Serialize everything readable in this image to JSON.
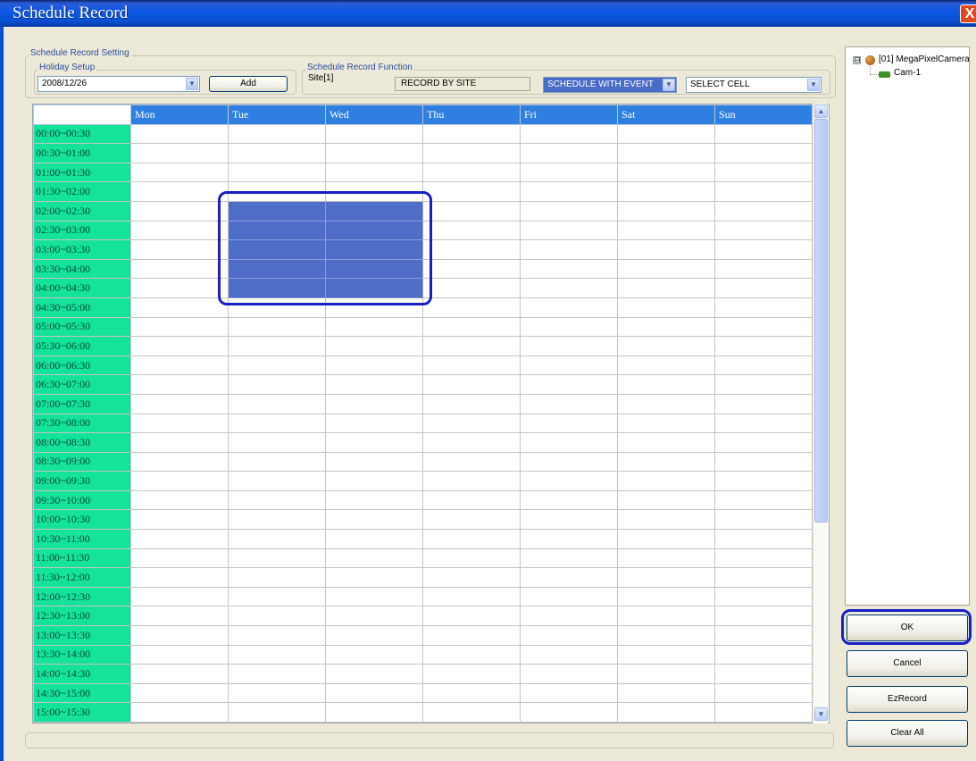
{
  "window": {
    "title": "Schedule Record",
    "close_glyph": "X"
  },
  "settings": {
    "group_label": "Schedule Record Setting",
    "holiday": {
      "label": "Holiday Setup",
      "date_value": "2008/12/26",
      "add_label": "Add"
    },
    "function": {
      "label": "Schedule Record Function",
      "site_label": "Site[1]",
      "record_mode": "RECORD BY SITE",
      "schedule_mode": "SCHEDULE WITH EVENT",
      "cell_mode": "SELECT CELL"
    }
  },
  "grid": {
    "days": [
      "Mon",
      "Tue",
      "Wed",
      "Thu",
      "Fri",
      "Sat",
      "Sun"
    ],
    "times": [
      "00:00~00:30",
      "00:30~01:00",
      "01:00~01:30",
      "01:30~02:00",
      "02:00~02:30",
      "02:30~03:00",
      "03:00~03:30",
      "03:30~04:00",
      "04:00~04:30",
      "04:30~05:00",
      "05:00~05:30",
      "05:30~06:00",
      "06:00~06:30",
      "06:30~07:00",
      "07:00~07:30",
      "07:30~08:00",
      "08:00~08:30",
      "08:30~09:00",
      "09:00~09:30",
      "09:30~10:00",
      "10:00~10:30",
      "10:30~11:00",
      "11:00~11:30",
      "11:30~12:00",
      "12:00~12:30",
      "12:30~13:00",
      "13:00~13:30",
      "13:30~14:00",
      "14:00~14:30",
      "14:30~15:00",
      "15:00~15:30"
    ],
    "selected": {
      "days": [
        "Tue",
        "Wed"
      ],
      "times": [
        "02:00~02:30",
        "02:30~03:00",
        "03:00~03:30",
        "03:30~04:00",
        "04:00~04:30"
      ]
    },
    "selected_color": "#4F6CC7",
    "time_cell_color": "#16E39A",
    "header_color": "#2F7FE0"
  },
  "tree": {
    "root_label": "[01] MegaPixelCamera",
    "root_icon": "globe-icon",
    "expander_glyph": "⊟",
    "children": [
      {
        "label": "Cam-1",
        "icon": "camera-icon"
      }
    ]
  },
  "actions": {
    "ok_label": "OK",
    "cancel_label": "Cancel",
    "ezrecord_label": "EzRecord",
    "clear_all_label": "Clear All"
  },
  "highlight_color": "#1A1FC4"
}
